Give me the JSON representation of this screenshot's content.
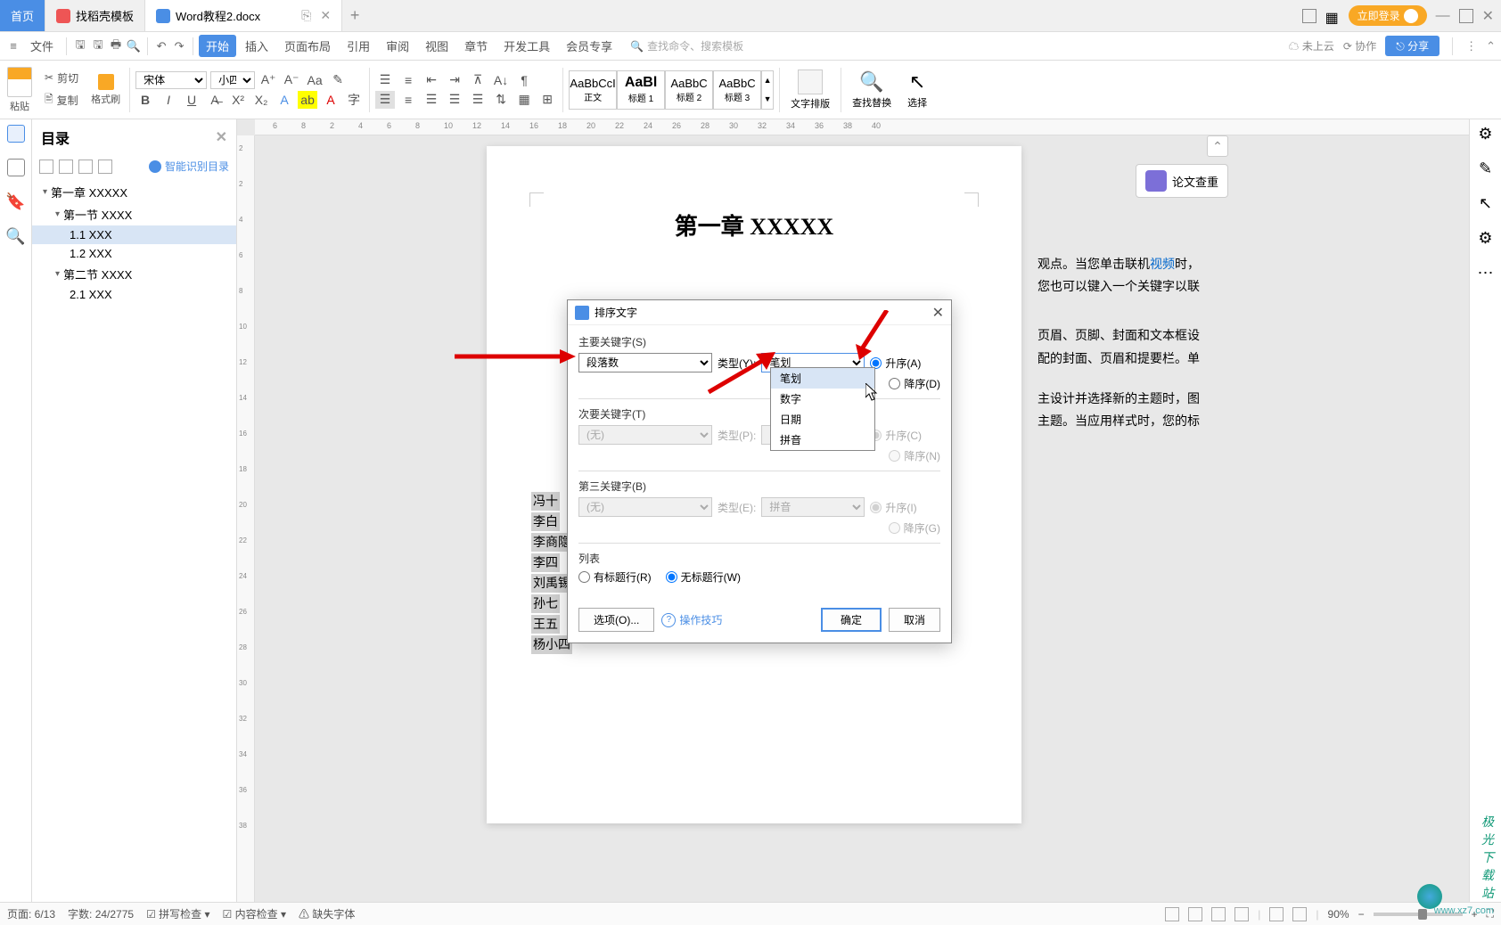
{
  "tabs": {
    "home": "首页",
    "template": "找稻壳模板",
    "doc": "Word教程2.docx"
  },
  "login": "立即登录",
  "menus": {
    "file": "文件",
    "start": "开始",
    "insert": "插入",
    "layout": "页面布局",
    "reference": "引用",
    "review": "审阅",
    "view": "视图",
    "chapter": "章节",
    "devtools": "开发工具",
    "member": "会员专享",
    "search_ph": "查找命令、搜索模板",
    "cloud": "未上云",
    "coop": "协作",
    "share": "分享"
  },
  "toolbar": {
    "paste": "粘贴",
    "cut": "剪切",
    "copy": "复制",
    "fmt_painter": "格式刷",
    "font": "宋体",
    "font_size": "小四",
    "styles": {
      "normal_preview": "AaBbCcI",
      "normal": "正文",
      "h1_preview": "AaBl",
      "h1": "标题 1",
      "h2_preview": "AaBbC",
      "h2": "标题 2",
      "h3_preview": "AaBbC",
      "h3": "标题 3"
    },
    "text_layout": "文字排版",
    "find_replace": "查找替换",
    "select": "选择"
  },
  "outline": {
    "title": "目录",
    "smart": "智能识别目录",
    "items": [
      {
        "level": 1,
        "text": "第一章  XXXXX"
      },
      {
        "level": 2,
        "text": "第一节  XXXX"
      },
      {
        "level": 3,
        "text": "1.1 XXX",
        "selected": true
      },
      {
        "level": 3,
        "text": "1.2 XXX"
      },
      {
        "level": 2,
        "text": "第二节  XXXX"
      },
      {
        "level": 3,
        "text": "2.1 XXX"
      }
    ]
  },
  "page": {
    "title": "第一章  XXXXX",
    "body_fragment_1": "观点。当您单击联机",
    "body_link": "视频",
    "body_fragment_2": "时，",
    "body_fragment_3": "您也可以键入一个关键字以联",
    "body_fragment_4": "页眉、页脚、封面和文本框设",
    "body_fragment_5": "配的封面、页眉和提要栏。单",
    "body_fragment_6": "主设计并选择新的主题时，图",
    "body_fragment_7": "主题。当应用样式时，您的标",
    "names": [
      "冯十",
      "李白",
      "李商隐",
      "李四",
      "刘禹锡",
      "孙七",
      "王五",
      "杨小四"
    ]
  },
  "thesis": "论文查重",
  "dialog": {
    "title": "排序文字",
    "primary_label": "主要关键字(S)",
    "primary_value": "段落数",
    "type_y": "类型(Y):",
    "type_y_value": "笔划",
    "asc_a": "升序(A)",
    "desc_d": "降序(D)",
    "secondary_label": "次要关键字(T)",
    "secondary_value": "(无)",
    "type_p": "类型(P):",
    "asc_c": "升序(C)",
    "desc_n": "降序(N)",
    "third_label": "第三关键字(B)",
    "third_value": "(无)",
    "type_e": "类型(E):",
    "type_e_value": "拼音",
    "asc_i": "升序(I)",
    "desc_g": "降序(G)",
    "list_label": "列表",
    "has_header": "有标题行(R)",
    "no_header": "无标题行(W)",
    "options": "选项(O)...",
    "tips": "操作技巧",
    "ok": "确定",
    "cancel": "取消",
    "dropdown_options": [
      "笔划",
      "数字",
      "日期",
      "拼音"
    ]
  },
  "ruler_h": [
    6,
    8,
    2,
    4,
    6,
    8,
    10,
    12,
    14,
    16,
    18,
    20,
    22,
    24,
    26,
    28,
    30,
    32,
    34,
    36,
    38,
    40
  ],
  "ruler_v": [
    2,
    2,
    4,
    6,
    8,
    10,
    12,
    14,
    16,
    18,
    20,
    22,
    24,
    26,
    28,
    30,
    32,
    34,
    36,
    38
  ],
  "statusbar": {
    "page": "页面: 6/13",
    "words": "字数: 24/2775",
    "spell": "拼写检查",
    "content": "内容检查",
    "missing_font": "缺失字体",
    "zoom": "90%"
  },
  "watermark": {
    "site": "极光下载站",
    "url": "www.xz7.com"
  }
}
